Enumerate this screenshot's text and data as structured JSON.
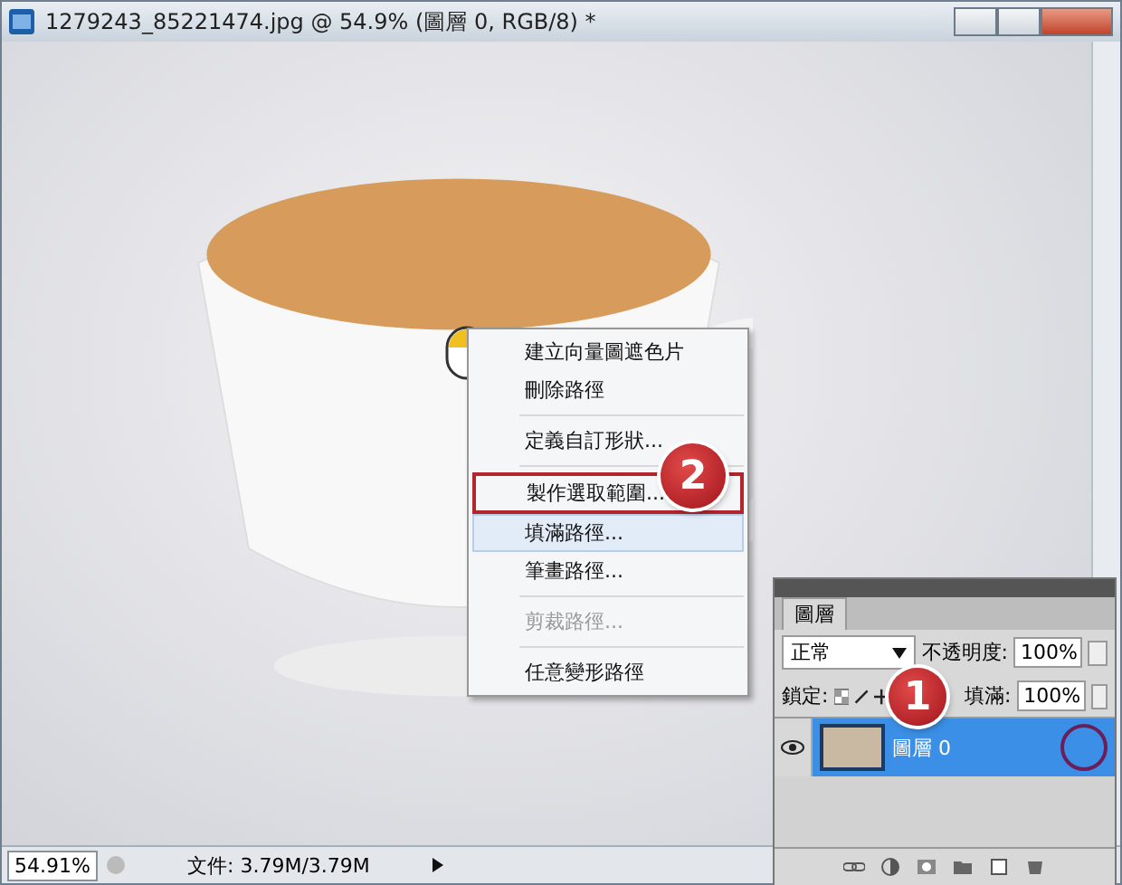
{
  "window": {
    "title": "1279243_85221474.jpg @ 54.9% (圖層 0, RGB/8) *"
  },
  "context_menu": {
    "items": [
      {
        "kind": "item",
        "label": "建立向量圖遮色片",
        "disabled": false,
        "selected": false,
        "outlined": false
      },
      {
        "kind": "item",
        "label": "刪除路徑",
        "disabled": false,
        "selected": false,
        "outlined": false
      },
      {
        "kind": "separator"
      },
      {
        "kind": "item",
        "label": "定義自訂形狀...",
        "disabled": false,
        "selected": false,
        "outlined": false
      },
      {
        "kind": "separator"
      },
      {
        "kind": "item",
        "label": "製作選取範圍...",
        "disabled": false,
        "selected": false,
        "outlined": true
      },
      {
        "kind": "item",
        "label": "填滿路徑...",
        "disabled": false,
        "selected": true,
        "outlined": false
      },
      {
        "kind": "item",
        "label": "筆畫路徑...",
        "disabled": false,
        "selected": false,
        "outlined": false
      },
      {
        "kind": "separator"
      },
      {
        "kind": "item",
        "label": "剪裁路徑...",
        "disabled": true,
        "selected": false,
        "outlined": false
      },
      {
        "kind": "separator"
      },
      {
        "kind": "item",
        "label": "任意變形路徑",
        "disabled": false,
        "selected": false,
        "outlined": false
      }
    ]
  },
  "step_badges": [
    "1",
    "2"
  ],
  "layers_panel": {
    "tab": "圖層",
    "blend_mode": "正常",
    "opacity_label": "不透明度:",
    "opacity": "100%",
    "lock_label": "鎖定:",
    "fill_label": "填滿:",
    "fill": "100%",
    "layers": [
      {
        "name": "圖層 0",
        "selected": true,
        "visible": true
      }
    ]
  },
  "status_bar": {
    "zoom": "54.91%",
    "doc_info": "文件: 3.79M/3.79M"
  }
}
